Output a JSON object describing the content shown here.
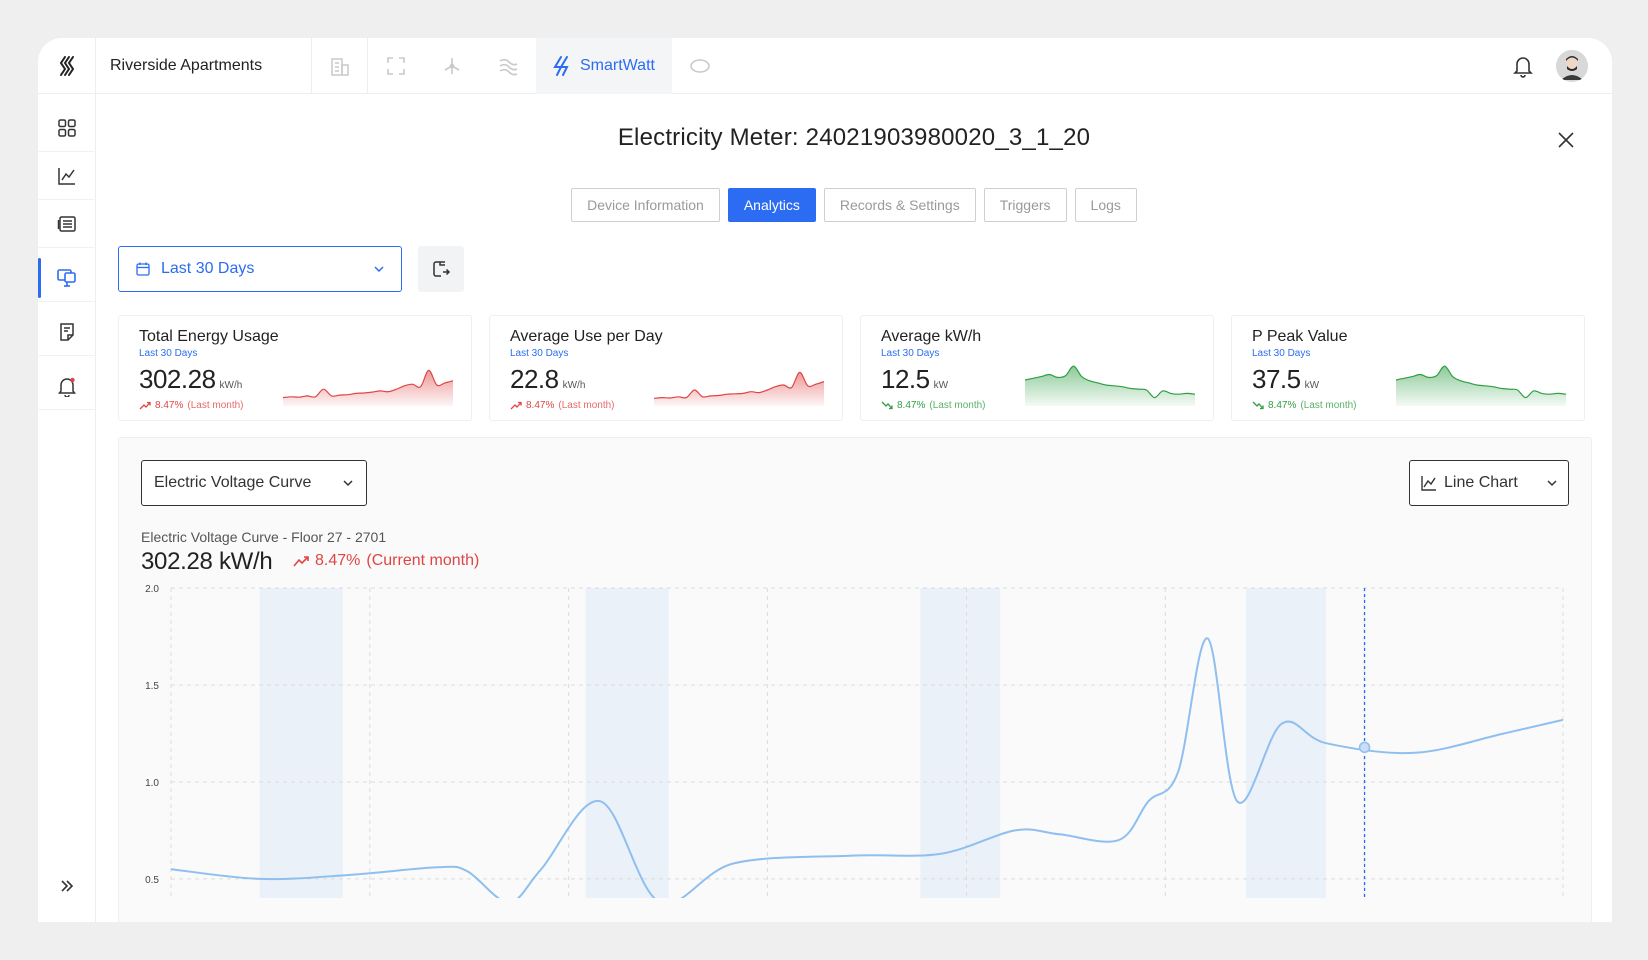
{
  "header": {
    "project_name": "Riverside Apartments",
    "active_app": "SmartWatt",
    "app_icons": [
      "building-icon",
      "fullscreen-icon",
      "fan-icon",
      "wind-icon",
      "smartwatt-icon",
      "ring-icon"
    ],
    "accent": "#2b6cf3"
  },
  "sidebar": {
    "items": [
      "dashboard-icon",
      "analytics-chart-icon",
      "list-icon",
      "monitor-icon",
      "note-icon",
      "alert-bell-icon"
    ],
    "active_index": 3
  },
  "modal": {
    "title": "Electricity Meter: 24021903980020_3_1_20",
    "tabs": [
      {
        "label": "Device Information",
        "active": false
      },
      {
        "label": "Analytics",
        "active": true
      },
      {
        "label": "Records & Settings",
        "active": false
      },
      {
        "label": "Triggers",
        "active": false
      },
      {
        "label": "Logs",
        "active": false
      }
    ]
  },
  "date_range": {
    "label": "Last 30 Days"
  },
  "kpis": [
    {
      "title": "Total Energy Usage",
      "subtitle": "Last 30 Days",
      "value": "302.28",
      "unit": "kW/h",
      "change": "8.47%",
      "context": "(Last month)",
      "trend": "up",
      "color": "#e04545",
      "spark": [
        0.2,
        0.22,
        0.21,
        0.24,
        0.22,
        0.4,
        0.24,
        0.26,
        0.27,
        0.3,
        0.31,
        0.33,
        0.36,
        0.34,
        0.4,
        0.48,
        0.52,
        0.46,
        0.85,
        0.5,
        0.55,
        0.6
      ]
    },
    {
      "title": "Average Use per Day",
      "subtitle": "Last 30 Days",
      "value": "22.8",
      "unit": "kW/h",
      "change": "8.47%",
      "context": "(Last month)",
      "trend": "up",
      "color": "#e04545",
      "spark": [
        0.18,
        0.2,
        0.19,
        0.22,
        0.2,
        0.38,
        0.22,
        0.24,
        0.25,
        0.28,
        0.29,
        0.3,
        0.34,
        0.32,
        0.38,
        0.46,
        0.5,
        0.44,
        0.8,
        0.48,
        0.52,
        0.58
      ]
    },
    {
      "title": "Average kW/h",
      "subtitle": "Last 30 Days",
      "value": "12.5",
      "unit": "kW",
      "change": "8.47%",
      "context": "(Last month)",
      "trend": "down",
      "color": "#2f9e44",
      "spark": [
        0.62,
        0.66,
        0.7,
        0.75,
        0.68,
        0.72,
        0.95,
        0.7,
        0.6,
        0.55,
        0.5,
        0.48,
        0.46,
        0.42,
        0.4,
        0.38,
        0.2,
        0.36,
        0.3,
        0.28,
        0.3,
        0.28
      ]
    },
    {
      "title": "P Peak Value",
      "subtitle": "Last 30 Days",
      "value": "37.5",
      "unit": "kW",
      "change": "8.47%",
      "context": "(Last month)",
      "trend": "down",
      "color": "#2f9e44",
      "spark": [
        0.62,
        0.66,
        0.7,
        0.75,
        0.68,
        0.72,
        0.95,
        0.7,
        0.6,
        0.55,
        0.5,
        0.48,
        0.46,
        0.42,
        0.4,
        0.38,
        0.2,
        0.36,
        0.3,
        0.28,
        0.3,
        0.28
      ]
    }
  ],
  "chart_panel": {
    "curve_select": "Electric Voltage Curve",
    "type_select": "Line Chart",
    "label": "Electric Voltage Curve - Floor 27 - 2701",
    "value": "302.28 kW/h",
    "change": "8.47%",
    "change_context": "(Current month)"
  },
  "chart_data": {
    "type": "line",
    "ylim": [
      0.35,
      2.0
    ],
    "y_ticks": [
      "2.0",
      "1.5",
      "1.0",
      "0.5"
    ],
    "y_tick_values": [
      2.0,
      1.5,
      1.0,
      0.5
    ],
    "x": [
      0,
      3,
      6,
      9,
      10,
      11.4,
      12.5,
      14.5,
      16.5,
      19,
      23,
      26,
      28.5,
      30,
      32,
      33,
      34,
      35,
      36,
      37.5,
      39,
      42,
      45,
      47
    ],
    "values": [
      0.55,
      0.5,
      0.52,
      0.56,
      0.54,
      0.38,
      0.55,
      0.9,
      0.38,
      0.58,
      0.62,
      0.63,
      0.75,
      0.73,
      0.7,
      0.9,
      1.05,
      1.74,
      0.9,
      1.3,
      1.2,
      1.15,
      1.25,
      1.32
    ],
    "xlim": [
      0,
      47
    ],
    "highlight_bands": [
      [
        3,
        5.8
      ],
      [
        14,
        16.8
      ],
      [
        25.3,
        28
      ],
      [
        36.3,
        39
      ]
    ],
    "marker_x": 40.3,
    "line_color": "#8fbfee",
    "band_color": "#eaf1f9",
    "marker_color": "#2b6cf3"
  }
}
